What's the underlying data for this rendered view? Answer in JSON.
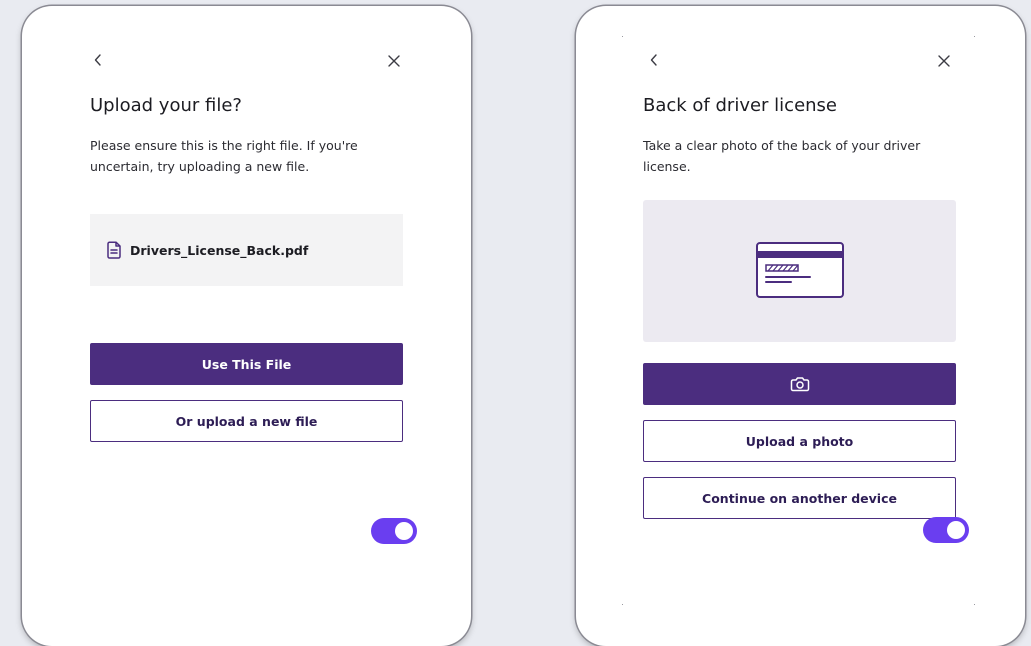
{
  "left_card": {
    "title": "Upload your file?",
    "description": "Please ensure this is the right file. If you're uncertain, try uploading a new file.",
    "file": {
      "icon": "document-icon",
      "name": "Drivers_License_Back.pdf"
    },
    "primary_button": "Use This File",
    "secondary_button": "Or upload a new file",
    "toggle_on": true
  },
  "right_card": {
    "title": "Back of driver license",
    "description": "Take a clear photo of the back of your driver license.",
    "preview_icon": "card-back-icon",
    "camera_button_icon": "camera-icon",
    "upload_button": "Upload a photo",
    "continue_button": "Continue on another device",
    "toggle_on": true
  },
  "nav": {
    "back_icon": "chevron-left-icon",
    "close_icon": "close-icon"
  },
  "colors": {
    "brand_purple": "#4b2d7f",
    "toggle_purple": "#6a3ef0",
    "file_box_bg": "#f3f3f4",
    "preview_bg": "#eceaf1",
    "page_bg": "#e9ebf1"
  }
}
